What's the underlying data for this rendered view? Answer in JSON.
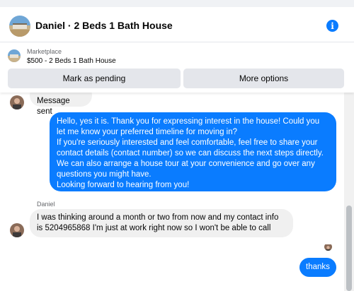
{
  "header": {
    "title": "Daniel · 2 Beds 1 Bath House",
    "info_icon": "info-icon"
  },
  "listing": {
    "label": "Marketplace",
    "detail": "$500 - 2 Beds 1 Bath House",
    "buttons": {
      "pending": "Mark as pending",
      "more": "More options"
    }
  },
  "messages": [
    {
      "from": "Daniel",
      "text": "Message sent"
    },
    {
      "from": "me",
      "paragraphs": [
        "Hello, yes it is. Thank you for expressing interest in the house! Could you let me know your preferred timeline for moving in?",
        "If you're seriously interested and feel comfortable, feel free to share your contact details (contact number) so we can discuss the next steps directly. We can also arrange a house tour at your convenience and go over any questions you might have.",
        "Looking forward to hearing from you!"
      ]
    },
    {
      "from": "Daniel",
      "sender_name": "Daniel",
      "text": "I was thinking around a month or two from now and my contact info is 5204965868 I'm just at work right now so I won't be able to call"
    },
    {
      "from": "me",
      "text": "thanks"
    }
  ],
  "colors": {
    "accent": "#0a7cff",
    "incoming_bubble": "#f0f0f0",
    "button_bg": "#e4e6eb",
    "secondary_text": "#65676b"
  }
}
